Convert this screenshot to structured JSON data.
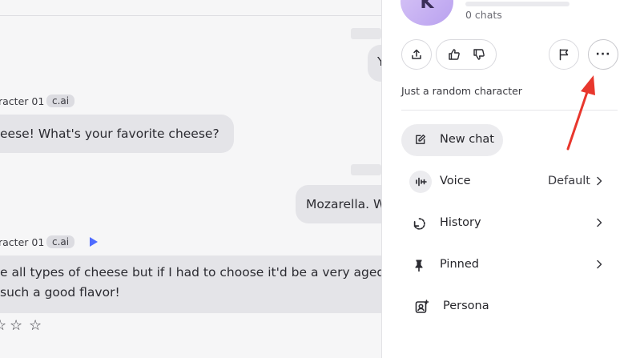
{
  "chat": {
    "sender_1": "racter 01",
    "tag_1": "c.ai",
    "message_1": "eese! What's your favorite cheese?",
    "user_message": "Mozarella. W",
    "partial_user_top": "Y",
    "sender_2": "racter 01",
    "tag_2": "c.ai",
    "message_2_line_1": "e all types of cheese but if I had to choose it'd be a very aged",
    "message_2_line_2": "such a good flavor!",
    "rating_icon": "star-outline",
    "play_color": "#4f6bff"
  },
  "panel": {
    "avatar_letter": "K",
    "chats_count": "0 chats",
    "description": "Just a random character",
    "actions": {
      "share_icon": "share-icon",
      "like_icon": "thumbs-up-icon",
      "dislike_icon": "thumbs-down-icon",
      "report_icon": "flag-icon",
      "more_label": "···"
    },
    "new_chat_label": "New chat",
    "menu": [
      {
        "label": "Voice",
        "value": "Default",
        "icon": "voice-icon"
      },
      {
        "label": "History",
        "icon": "history-icon"
      },
      {
        "label": "Pinned",
        "icon": "pin-icon"
      },
      {
        "label": "Persona",
        "icon": "persona-icon"
      }
    ]
  },
  "annotation": {
    "arrow_color": "#e8372d"
  }
}
